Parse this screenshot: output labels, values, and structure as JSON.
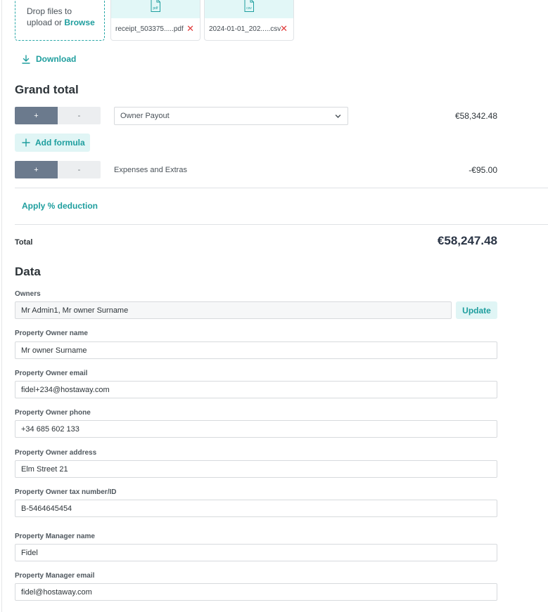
{
  "upload": {
    "drop_text": "Drop files to",
    "drop_text_2": "upload or",
    "browse": "Browse",
    "files": [
      {
        "ext": "pdf",
        "name": "receipt_503375.....pdf"
      },
      {
        "ext": "csv",
        "name": "2024-01-01_202.....csv"
      }
    ],
    "download_label": "Download"
  },
  "grand_total": {
    "title": "Grand total",
    "rows": [
      {
        "plus": "+",
        "minus": "-",
        "select_value": "Owner Payout",
        "amount": "€58,342.48"
      },
      {
        "plus": "+",
        "minus": "-",
        "label": "Expenses and Extras",
        "amount": "-€95.00"
      }
    ],
    "add_formula": "Add formula",
    "apply_deduction": "Apply % deduction",
    "total_label": "Total",
    "total_value": "€58,247.48"
  },
  "data_section": {
    "title": "Data",
    "owners_label": "Owners",
    "owners_value": "Mr Admin1, Mr owner Surname",
    "update_label": "Update",
    "fields": [
      {
        "label": "Property Owner name",
        "value": "Mr owner Surname"
      },
      {
        "label": "Property Owner email",
        "value": "fidel+234@hostaway.com"
      },
      {
        "label": "Property Owner phone",
        "value": "+34 685 602 133"
      },
      {
        "label": "Property Owner address",
        "value": "Elm Street 21"
      },
      {
        "label": "Property Owner tax number/ID",
        "value": "B-5464645454"
      },
      {
        "label": "Property Manager name",
        "value": "Fidel"
      },
      {
        "label": "Property Manager email",
        "value": "fidel@hostaway.com"
      }
    ]
  },
  "colors": {
    "accent": "#1e9e9e",
    "plus_bg": "#6b7a8d",
    "delete": "#e03a3a",
    "light_accent_bg": "#e0f5f5"
  }
}
